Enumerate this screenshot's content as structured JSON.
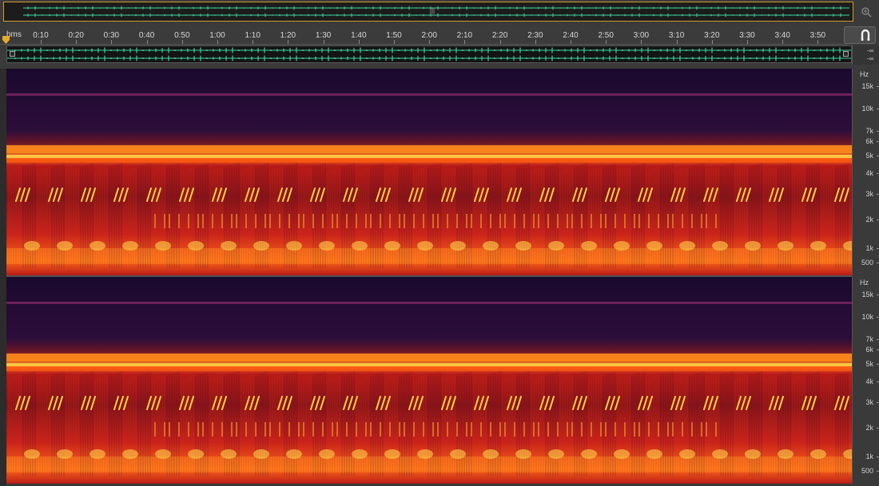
{
  "overview": {
    "handle_glyph": "|||"
  },
  "ruler": {
    "unit_label": "hms",
    "ticks": [
      "0:10",
      "0:20",
      "0:30",
      "0:40",
      "0:50",
      "1:00",
      "1:10",
      "1:20",
      "1:30",
      "1:40",
      "1:50",
      "2:00",
      "2:10",
      "2:20",
      "2:30",
      "2:40",
      "2:50",
      "3:00",
      "3:10",
      "3:20",
      "3:30",
      "3:40",
      "3:50"
    ]
  },
  "waveform": {
    "db_top": "-∞",
    "db_bottom": "-∞"
  },
  "channels": [
    {
      "unit_label": "Hz",
      "freq_labels": [
        "15k",
        "10k",
        "7k",
        "6k",
        "5k",
        "4k",
        "3k",
        "2k",
        "1k",
        "500"
      ]
    },
    {
      "unit_label": "Hz",
      "freq_labels": [
        "15k",
        "10k",
        "7k",
        "6k",
        "5k",
        "4k",
        "3k",
        "2k",
        "1k",
        "500"
      ]
    }
  ],
  "colors": {
    "accent": "#d39b2c",
    "waveform": "#3fd6a0",
    "spectrogram_low": "#1a0a2e",
    "spectrogram_mid": "#c8221a",
    "spectrogram_high": "#ffd24a"
  }
}
